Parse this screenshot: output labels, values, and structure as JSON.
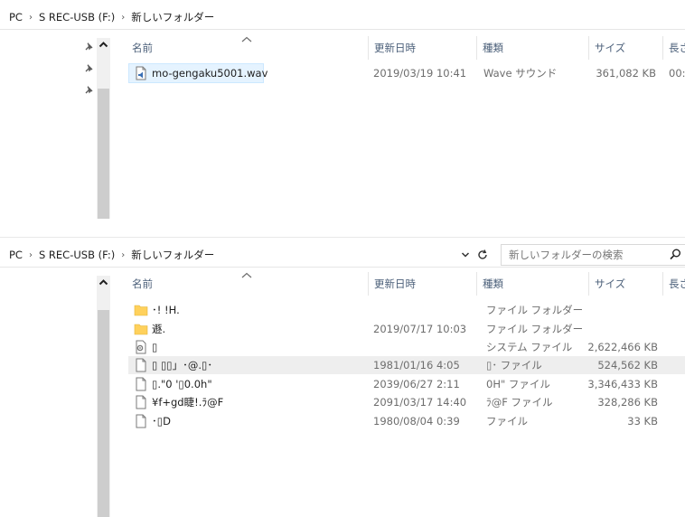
{
  "top": {
    "breadcrumb": [
      "PC",
      "S REC-USB (F:)",
      "新しいフォルダー"
    ],
    "columns": {
      "name": "名前",
      "date": "更新日時",
      "type": "種類",
      "size": "サイズ",
      "length": "長さ"
    },
    "files": [
      {
        "name": "mo-gengaku5001.wav",
        "date": "2019/03/19 10:41",
        "type": "Wave サウンド",
        "size": "361,082 KB",
        "length": "00:",
        "icon": "wave-file-icon"
      }
    ]
  },
  "bottom": {
    "breadcrumb": [
      "PC",
      "S REC-USB (F:)",
      "新しいフォルダー"
    ],
    "search_placeholder": "新しいフォルダーの検索",
    "columns": {
      "name": "名前",
      "date": "更新日時",
      "type": "種類",
      "size": "サイズ",
      "length": "長さ"
    },
    "files": [
      {
        "name": "･! !H.",
        "date": "",
        "type": "ファイル フォルダー",
        "size": "",
        "icon": "folder-icon"
      },
      {
        "name": "遯.",
        "date": "2019/07/17 10:03",
        "type": "ファイル フォルダー",
        "size": "",
        "icon": "folder-icon"
      },
      {
        "name": "▯",
        "date": "",
        "type": "システム ファイル",
        "size": "2,622,466 KB",
        "icon": "system-file-icon"
      },
      {
        "name": "▯ ▯▯」･@.▯･",
        "date": "1981/01/16 4:05",
        "type": "▯･ ファイル",
        "size": "524,562 KB",
        "icon": "file-icon"
      },
      {
        "name": "▯.\"0 '▯0.0h\"",
        "date": "2039/06/27 2:11",
        "type": "0H\" ファイル",
        "size": "3,346,433 KB",
        "icon": "file-icon"
      },
      {
        "name": "¥f+gd睫!.ﾗ@F",
        "date": "2091/03/17 14:40",
        "type": "ﾗ@F ファイル",
        "size": "328,286 KB",
        "icon": "file-icon"
      },
      {
        "name": "･▯D",
        "date": "1980/08/04 0:39",
        "type": "ファイル",
        "size": "33 KB",
        "icon": "file-icon"
      }
    ]
  },
  "colors": {
    "accent": "#0078d7",
    "folder": "#ffd15c",
    "scroll_thumb": "#cdcdcd",
    "header_text": "#4c607a"
  }
}
